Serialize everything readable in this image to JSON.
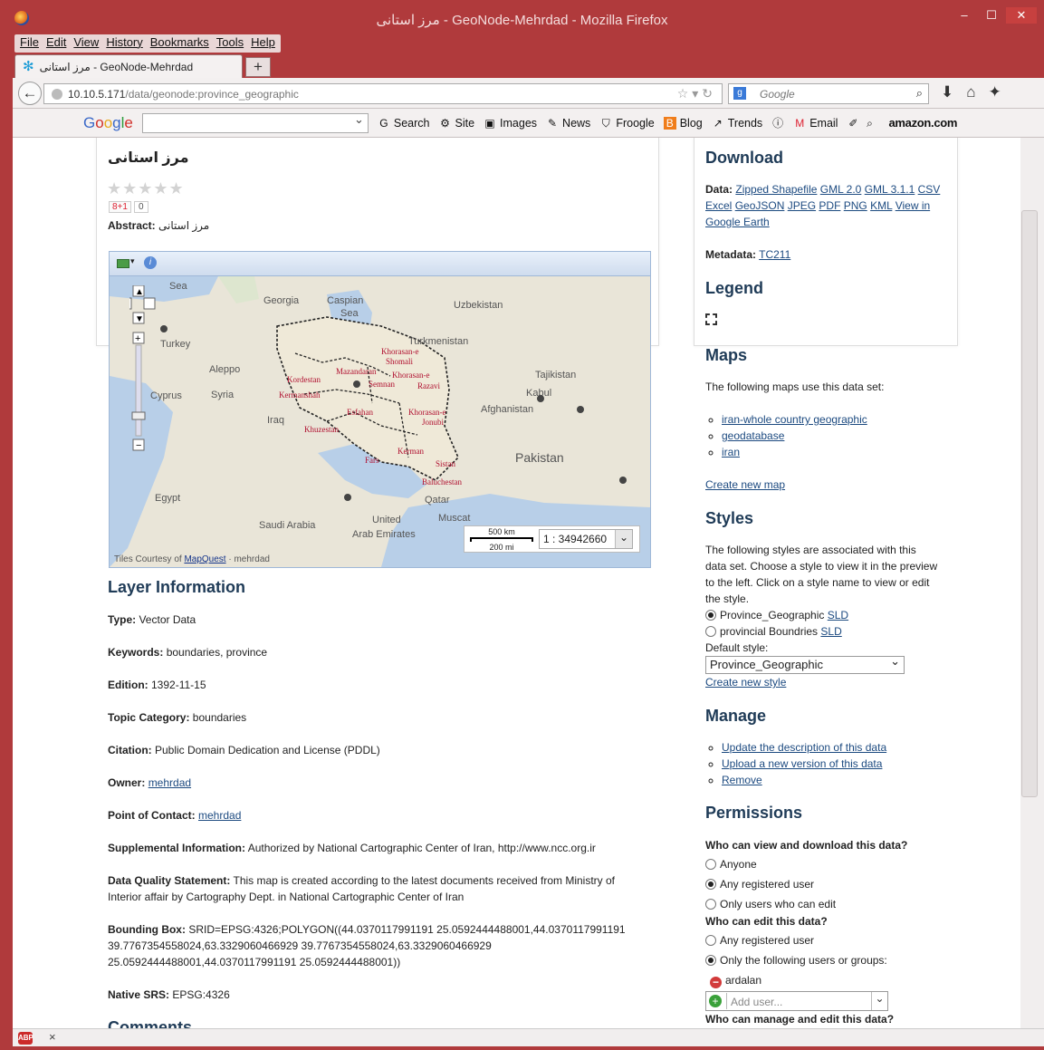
{
  "window": {
    "title": "مرز استانی - GeoNode-Mehrdad - Mozilla Firefox",
    "min": "–",
    "max": "☐",
    "close": "✕"
  },
  "menu": [
    "File",
    "Edit",
    "View",
    "History",
    "Bookmarks",
    "Tools",
    "Help"
  ],
  "tab": {
    "label": "مرز استانی - GeoNode-Mehrdad",
    "new_tab": "+"
  },
  "url": {
    "host": "10.10.5.171",
    "path": "/data/geonode:province_geographic"
  },
  "browser_search": {
    "placeholder": "Google"
  },
  "google_toolbar": {
    "logo": "Google",
    "items": [
      "Search",
      "Site",
      "Images",
      "News",
      "Froogle",
      "Blog",
      "Trends",
      "Email"
    ],
    "amazon": "amazon.com"
  },
  "layer": {
    "title": "مرز استانی",
    "rating_stars": "★★★★★",
    "gplus": "8+1",
    "gplus_count": "0",
    "abstract_label": "Abstract:",
    "abstract_value": "مرز استانی"
  },
  "map": {
    "scale_km": "500 km",
    "scale_mi": "200 mi",
    "scale_value": "1 : 34942660",
    "tiles_credit": "Tiles Courtesy of",
    "tiles_link": "MapQuest",
    "author": "mehrdad"
  },
  "info": {
    "heading": "Layer Information",
    "type_label": "Type:",
    "type_value": "Vector Data",
    "keywords_label": "Keywords:",
    "keywords_value": "boundaries, province",
    "edition_label": "Edition:",
    "edition_value": "1392-11-15",
    "topic_label": "Topic Category:",
    "topic_value": "boundaries",
    "citation_label": "Citation:",
    "citation_value": "Public Domain Dedication and License (PDDL)",
    "owner_label": "Owner:",
    "owner_value": "mehrdad",
    "poc_label": "Point of Contact:",
    "poc_value": "mehrdad",
    "supp_label": "Supplemental Information:",
    "supp_value": "Authorized by National Cartographic Center of Iran, http://www.ncc.org.ir",
    "dq_label": "Data Quality Statement:",
    "dq_value_1": "This map is created according to the latest documents received from Ministry of",
    "dq_value_2": "Interior affair by Cartography Dept. in National Cartographic Center of Iran",
    "bbox_label": "Bounding Box:",
    "bbox_1": "SRID=EPSG:4326;POLYGON((44.0370117991191 25.0592444488001,44.0370117991191",
    "bbox_2": "39.7767354558024,63.3329060466929 39.7767354558024,63.3329060466929",
    "bbox_3": "25.0592444488001,44.0370117991191 25.0592444488001))",
    "srs_label": "Native SRS:",
    "srs_value": "EPSG:4326",
    "comments": "Comments"
  },
  "download": {
    "heading": "Download",
    "data_label": "Data:",
    "formats": [
      "Zipped Shapefile",
      "GML 2.0",
      "GML 3.1.1",
      "CSV",
      "Excel",
      "GeoJSON",
      "JPEG",
      "PDF",
      "PNG",
      "KML",
      "View in Google Earth"
    ],
    "metadata_label": "Metadata:",
    "metadata_link": "TC211"
  },
  "legend": {
    "heading": "Legend"
  },
  "maps": {
    "heading": "Maps",
    "intro": "The following maps use this data set:",
    "items": [
      "iran-whole country geographic",
      "geodatabase",
      "iran"
    ],
    "create": "Create new map"
  },
  "styles": {
    "heading": "Styles",
    "intro_1": "The following styles are associated with this",
    "intro_2": "data set. Choose a style to view it in the preview",
    "intro_3": "to the left. Click on a style name to view or edit",
    "intro_4": "the style.",
    "opt1": "Province_Geographic",
    "opt2": "provincial Boundries",
    "sld": "SLD",
    "default_label": "Default style:",
    "default_value": "Province_Geographic",
    "create": "Create new style"
  },
  "manage": {
    "heading": "Manage",
    "items": [
      "Update the description of this data",
      "Upload a new version of this data",
      "Remove"
    ]
  },
  "permissions": {
    "heading": "Permissions",
    "q1": "Who can view and download this data?",
    "q1_opts": [
      "Anyone",
      "Any registered user",
      "Only users who can edit"
    ],
    "q2": "Who can edit this data?",
    "q2_opts": [
      "Any registered user",
      "Only the following users or groups:"
    ],
    "user": "ardalan",
    "add_user_placeholder": "Add user...",
    "q3": "Who can manage and edit this data?"
  },
  "status": {
    "abp": "ABP",
    "close": "×"
  }
}
